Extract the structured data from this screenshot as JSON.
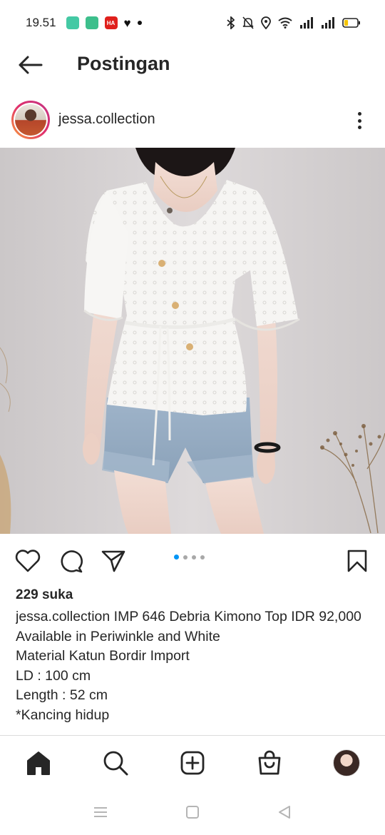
{
  "status_bar": {
    "time": "19.51",
    "notification_icons": [
      "app-icon-teal",
      "app-icon-green",
      "app-icon-red",
      "heart-icon",
      "dot"
    ],
    "notif_red_label": "HA",
    "system_icons": [
      "bluetooth-icon",
      "mute-icon",
      "location-icon",
      "wifi-icon",
      "signal-icon",
      "signal-icon",
      "battery-icon"
    ],
    "battery_level": 0.3
  },
  "header": {
    "back_icon": "arrow-left-icon",
    "title": "Postingan"
  },
  "post": {
    "username": "jessa.collection",
    "more_icon": "more-vertical-icon",
    "carousel": {
      "count": 4,
      "active_index": 0
    },
    "likes": "229 suka",
    "caption_user": "jessa.collection",
    "caption_lines": [
      " IMP 646 Debria Kimono Top IDR 92,000",
      "Available in Periwinkle and White",
      "Material Katun Bordir Import",
      "LD : 100 cm",
      "Length : 52 cm",
      "*Kancing hidup"
    ]
  },
  "actions": {
    "like_icon": "heart-icon",
    "comment_icon": "comment-icon",
    "share_icon": "send-icon",
    "save_icon": "bookmark-icon"
  },
  "bottom_nav": [
    "home-icon",
    "search-icon",
    "create-icon",
    "shop-icon",
    "profile-avatar"
  ],
  "system_nav": [
    "menu-icon",
    "home-square-icon",
    "back-triangle-icon"
  ],
  "colors": {
    "text": "#262626",
    "accent_blue": "#0095f6",
    "ring_gradient": [
      "#f9a13a",
      "#e1306c",
      "#c13584"
    ]
  }
}
